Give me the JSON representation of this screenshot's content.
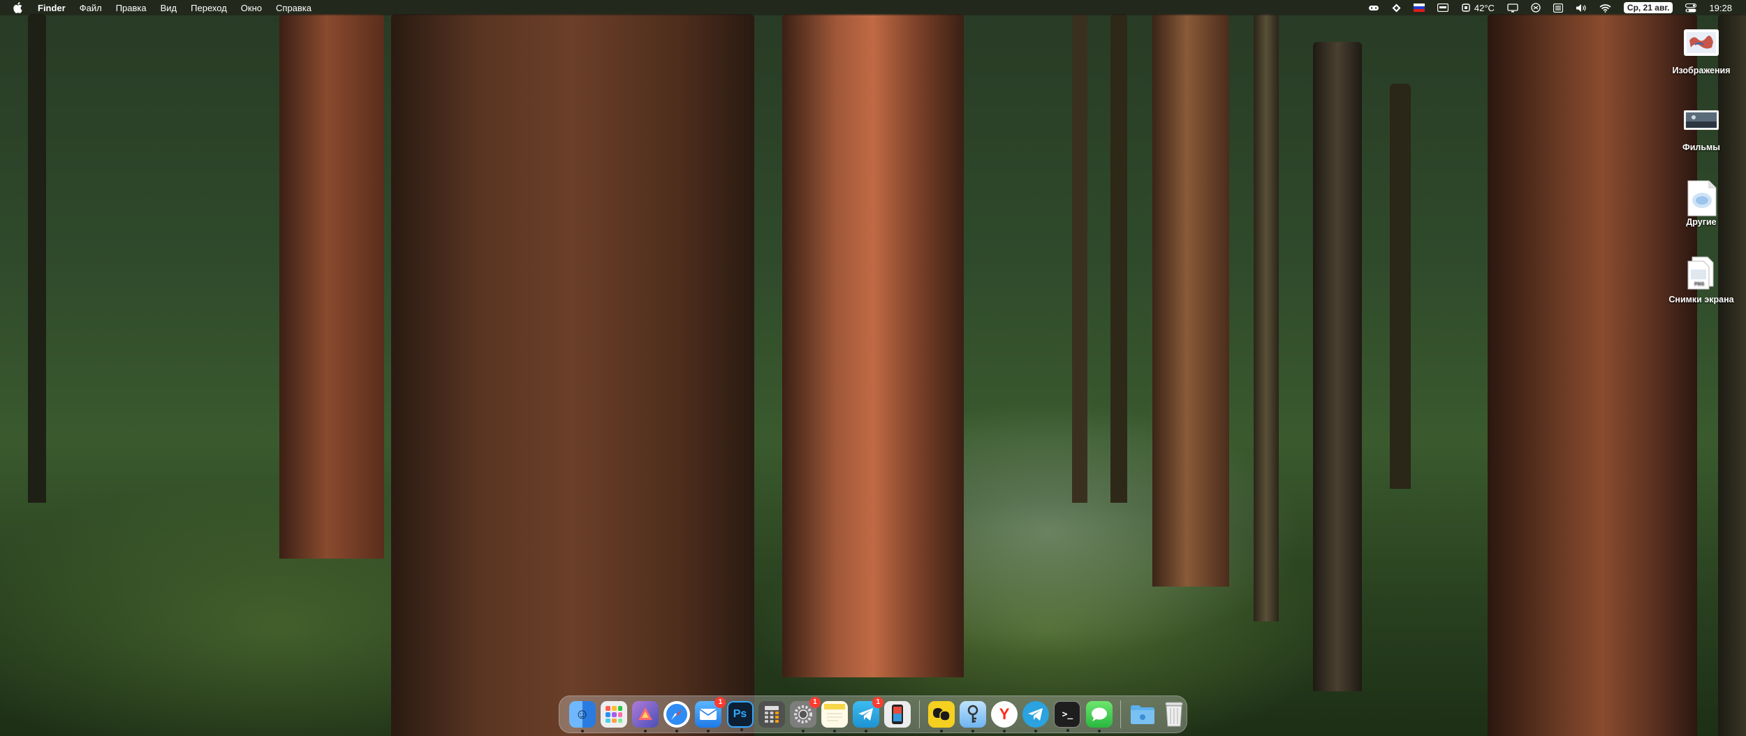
{
  "menubar": {
    "app_name": "Finder",
    "menus": [
      "Файл",
      "Правка",
      "Вид",
      "Переход",
      "Окно",
      "Справка"
    ],
    "status": {
      "temperature": "42°C",
      "date": "Ср, 21 авг.",
      "time": "19:28"
    }
  },
  "desktop_icons": [
    {
      "label": "Изображения"
    },
    {
      "label": "Фильмы"
    },
    {
      "label": "Другие"
    },
    {
      "label": "Снимки экрана"
    }
  ],
  "dock": {
    "apps": [
      {
        "name": "finder",
        "icon": "finder-icon",
        "color": "#3d8ef0"
      },
      {
        "name": "launchpad",
        "icon": "launchpad-icon",
        "color": "#f3f3f3"
      },
      {
        "name": "pixelmator",
        "icon": "pixelmator-icon",
        "color": "#7a5cc2"
      },
      {
        "name": "safari",
        "icon": "safari-icon",
        "color": "#2f8cf5"
      },
      {
        "name": "mail",
        "icon": "mail-icon",
        "color": "#3b9af5",
        "badge": "1"
      },
      {
        "name": "photoshop",
        "icon": "photoshop-icon",
        "color": "#0c1f33",
        "text": "Ps"
      },
      {
        "name": "calculator",
        "icon": "calculator-icon",
        "color": "#3a3a3a"
      },
      {
        "name": "system-settings",
        "icon": "gear-icon",
        "color": "#8a8a8a",
        "badge": "1"
      },
      {
        "name": "notes",
        "icon": "notes-icon",
        "color": "#f7e27a"
      },
      {
        "name": "telegram-lite",
        "icon": "telegram-icon",
        "color": "#2aa3e0",
        "badge": "1"
      },
      {
        "name": "mobile-app",
        "icon": "phone-icon",
        "color": "#e8e8e8"
      },
      {
        "name": "yandex-messenger",
        "icon": "chat-bubbles-icon",
        "color": "#f5d020"
      },
      {
        "name": "tips",
        "icon": "keychain-icon",
        "color": "#8fc7f2"
      },
      {
        "name": "yandex-browser",
        "icon": "yandex-icon",
        "color": "#ffffff",
        "text": "Y"
      },
      {
        "name": "telegram",
        "icon": "telegram-icon",
        "color": "#2aa3e0"
      },
      {
        "name": "terminal",
        "icon": "terminal-icon",
        "color": "#1e1e1e",
        "text": ">_"
      },
      {
        "name": "messages",
        "icon": "messages-icon",
        "color": "#3dc74f"
      }
    ],
    "stacks": [
      {
        "name": "downloads",
        "icon": "folder-icon",
        "color": "#4aa3e6"
      },
      {
        "name": "trash",
        "icon": "trash-icon",
        "color": "#d8d8d8"
      }
    ]
  }
}
